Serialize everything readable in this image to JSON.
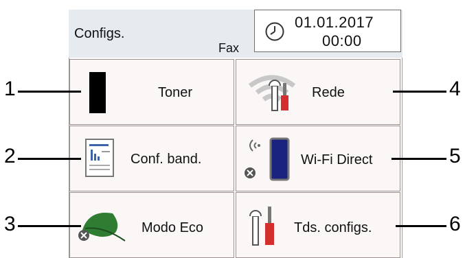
{
  "header": {
    "title": "Configs.",
    "fax_label": "Fax",
    "date": "01.01.2017",
    "time": "00:00"
  },
  "tiles": [
    {
      "label": "Toner",
      "icon": "toner-icon"
    },
    {
      "label": "Rede",
      "icon": "wifi-settings-icon"
    },
    {
      "label": "Conf. band.",
      "icon": "tray-settings-icon"
    },
    {
      "label": "Wi-Fi Direct",
      "icon": "wifi-direct-icon"
    },
    {
      "label": "Modo Eco",
      "icon": "eco-leaf-icon"
    },
    {
      "label": "Tds. configs.",
      "icon": "all-settings-icon"
    }
  ],
  "callouts": [
    "1",
    "2",
    "3",
    "4",
    "5",
    "6"
  ],
  "colors": {
    "header_bg": "#e6ebef",
    "tile_bg": "#fcf7f7",
    "leaf_green": "#2e7d32",
    "tool_red": "#d32f2f",
    "phone_blue": "#1a237e"
  }
}
